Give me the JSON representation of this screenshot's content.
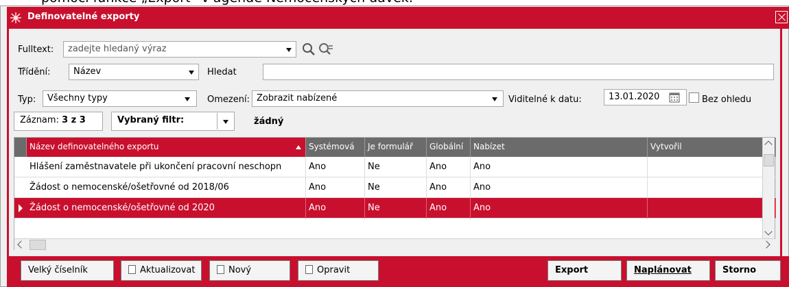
{
  "caption": "pomocí funkce „Export“ v agendě Nemocenských dávek.",
  "window": {
    "title": "Definovatelné exporty"
  },
  "filters": {
    "fulltext_label": "Fulltext:",
    "fulltext_placeholder": "zadejte hledaný výraz",
    "sort_label": "Třídění:",
    "sort_value": "Název",
    "search_label": "Hledat",
    "search_value": "",
    "type_label": "Typ:",
    "type_value": "Všechny typy",
    "restriction_label": "Omezení:",
    "restriction_value": "Zobrazit nabízené",
    "visible_label": "Viditelné k datu:",
    "visible_date": "13.01.2020",
    "ignore_label": "Bez ohledu"
  },
  "status": {
    "records_label": "Záznam:",
    "records_value": "3 z 3",
    "filter_label": "Vybraný filtr:",
    "filter_value": "žádný"
  },
  "grid": {
    "columns": [
      "Název definovatelného exportu",
      "Systémová",
      "Je formulář",
      "Globální",
      "Nabízet",
      "Vytvořil"
    ],
    "rows": [
      [
        "Hlášení zaměstnavatele při ukončení pracovní neschopn",
        "Ano",
        "Ne",
        "Ano",
        "Ano",
        ""
      ],
      [
        "Žádost o nemocenské/ošetřovné od 2018/06",
        "Ano",
        "Ne",
        "Ano",
        "Ano",
        ""
      ],
      [
        "Žádost o nemocenské/ošetřovné od 2020",
        "Ano",
        "Ne",
        "Ano",
        "Ano",
        ""
      ]
    ],
    "selected_row": 2
  },
  "buttons": {
    "big_list": "Velký číselník",
    "refresh": "Aktualizovat",
    "new": "Nový",
    "edit": "Opravit",
    "export": "Export",
    "schedule": "Naplánovat",
    "cancel": "Storno"
  },
  "colors": {
    "accent": "#c8102e",
    "header": "#6b6b6b"
  }
}
